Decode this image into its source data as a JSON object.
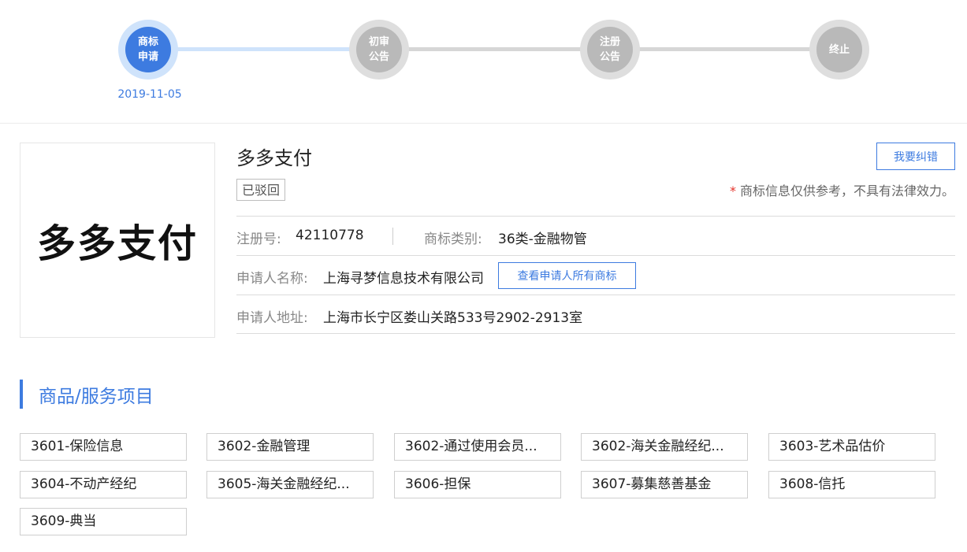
{
  "progress": {
    "steps": [
      {
        "label": "商标申请",
        "active": true
      },
      {
        "label": "初审公告",
        "active": false
      },
      {
        "label": "注册公告",
        "active": false
      },
      {
        "label": "终止",
        "active": false
      }
    ],
    "date": "2019-11-05"
  },
  "trademark": {
    "logo_text": "多多支付",
    "name": "多多支付",
    "status": "已驳回",
    "correct_button": "我要纠错",
    "disclaimer_star": "*",
    "disclaimer": "商标信息仅供参考，不具有法律效力。",
    "reg_no_label": "注册号:",
    "reg_no": "42110778",
    "class_label": "商标类别:",
    "class_value": "36类-金融物管",
    "applicant_label": "申请人名称:",
    "applicant": "上海寻梦信息技术有限公司",
    "view_all_button": "查看申请人所有商标",
    "address_label": "申请人地址:",
    "address": "上海市长宁区娄山关路533号2902-2913室"
  },
  "goods": {
    "title": "商品/服务项目",
    "items": [
      "3601-保险信息",
      "3602-金融管理",
      "3602-通过使用会员...",
      "3602-海关金融经纪...",
      "3603-艺术品估价",
      "3604-不动产经纪",
      "3605-海关金融经纪...",
      "3606-担保",
      "3607-募集慈善基金",
      "3608-信托",
      "3609-典当"
    ]
  },
  "colors": {
    "accent": "#3d7be0",
    "accent_light": "#cfe3fb",
    "inactive": "#b9b9b9",
    "danger": "#e5332a"
  }
}
